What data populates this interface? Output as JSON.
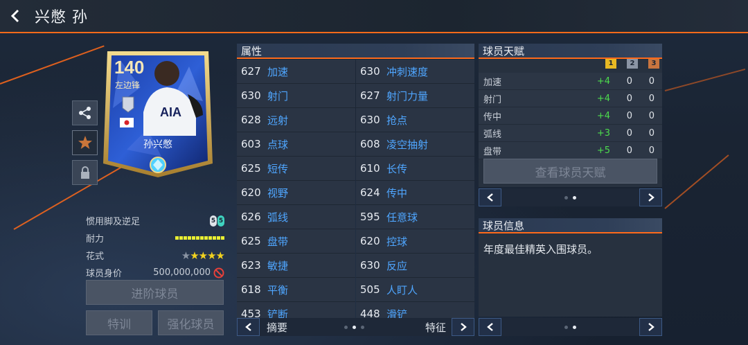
{
  "header": {
    "title": "兴憋 孙"
  },
  "card": {
    "rating": "140",
    "position": "左边锋",
    "name": "孙兴憋",
    "sponsor": "AIA"
  },
  "player_info": {
    "foot_label": "惯用脚及逆足",
    "foot_left": "5",
    "foot_right": "5",
    "stamina_label": "耐力",
    "skill_label": "花式",
    "skill_stars": 4,
    "value_label": "球员身价",
    "value": "500,000,000"
  },
  "buttons": {
    "upgrade": "进阶球员",
    "train": "特训",
    "enhance": "强化球员"
  },
  "attributes": {
    "title": "属性",
    "items": [
      {
        "value": "627",
        "name": "加速"
      },
      {
        "value": "630",
        "name": "冲刺速度"
      },
      {
        "value": "630",
        "name": "射门"
      },
      {
        "value": "627",
        "name": "射门力量"
      },
      {
        "value": "628",
        "name": "远射"
      },
      {
        "value": "630",
        "name": "抢点"
      },
      {
        "value": "603",
        "name": "点球"
      },
      {
        "value": "608",
        "name": "凌空抽射"
      },
      {
        "value": "625",
        "name": "短传"
      },
      {
        "value": "610",
        "name": "长传"
      },
      {
        "value": "620",
        "name": "视野"
      },
      {
        "value": "624",
        "name": "传中"
      },
      {
        "value": "626",
        "name": "弧线"
      },
      {
        "value": "595",
        "name": "任意球"
      },
      {
        "value": "625",
        "name": "盘带"
      },
      {
        "value": "620",
        "name": "控球"
      },
      {
        "value": "623",
        "name": "敏捷"
      },
      {
        "value": "630",
        "name": "反应"
      },
      {
        "value": "618",
        "name": "平衡"
      },
      {
        "value": "505",
        "name": "人盯人"
      },
      {
        "value": "453",
        "name": "铲断"
      },
      {
        "value": "448",
        "name": "滑铲"
      }
    ],
    "footer_left": "摘要",
    "footer_right": "特征"
  },
  "talent": {
    "title": "球员天赋",
    "ranks": [
      "1",
      "2",
      "3"
    ],
    "rank_colors": [
      "#e8b923",
      "#8b95a5",
      "#c8753f"
    ],
    "rows": [
      {
        "label": "加速",
        "a": "+4",
        "b": "0",
        "c": "0"
      },
      {
        "label": "射门",
        "a": "+4",
        "b": "0",
        "c": "0"
      },
      {
        "label": "传中",
        "a": "+4",
        "b": "0",
        "c": "0"
      },
      {
        "label": "弧线",
        "a": "+3",
        "b": "0",
        "c": "0"
      },
      {
        "label": "盘带",
        "a": "+5",
        "b": "0",
        "c": "0"
      }
    ],
    "view_button": "查看球员天赋"
  },
  "player_desc": {
    "title": "球员信息",
    "text": "年度最佳精英入围球员。"
  },
  "colors": {
    "accent": "#ff6a1a",
    "attr_name": "#4fa6ff",
    "bonus": "#4ddc4d"
  }
}
